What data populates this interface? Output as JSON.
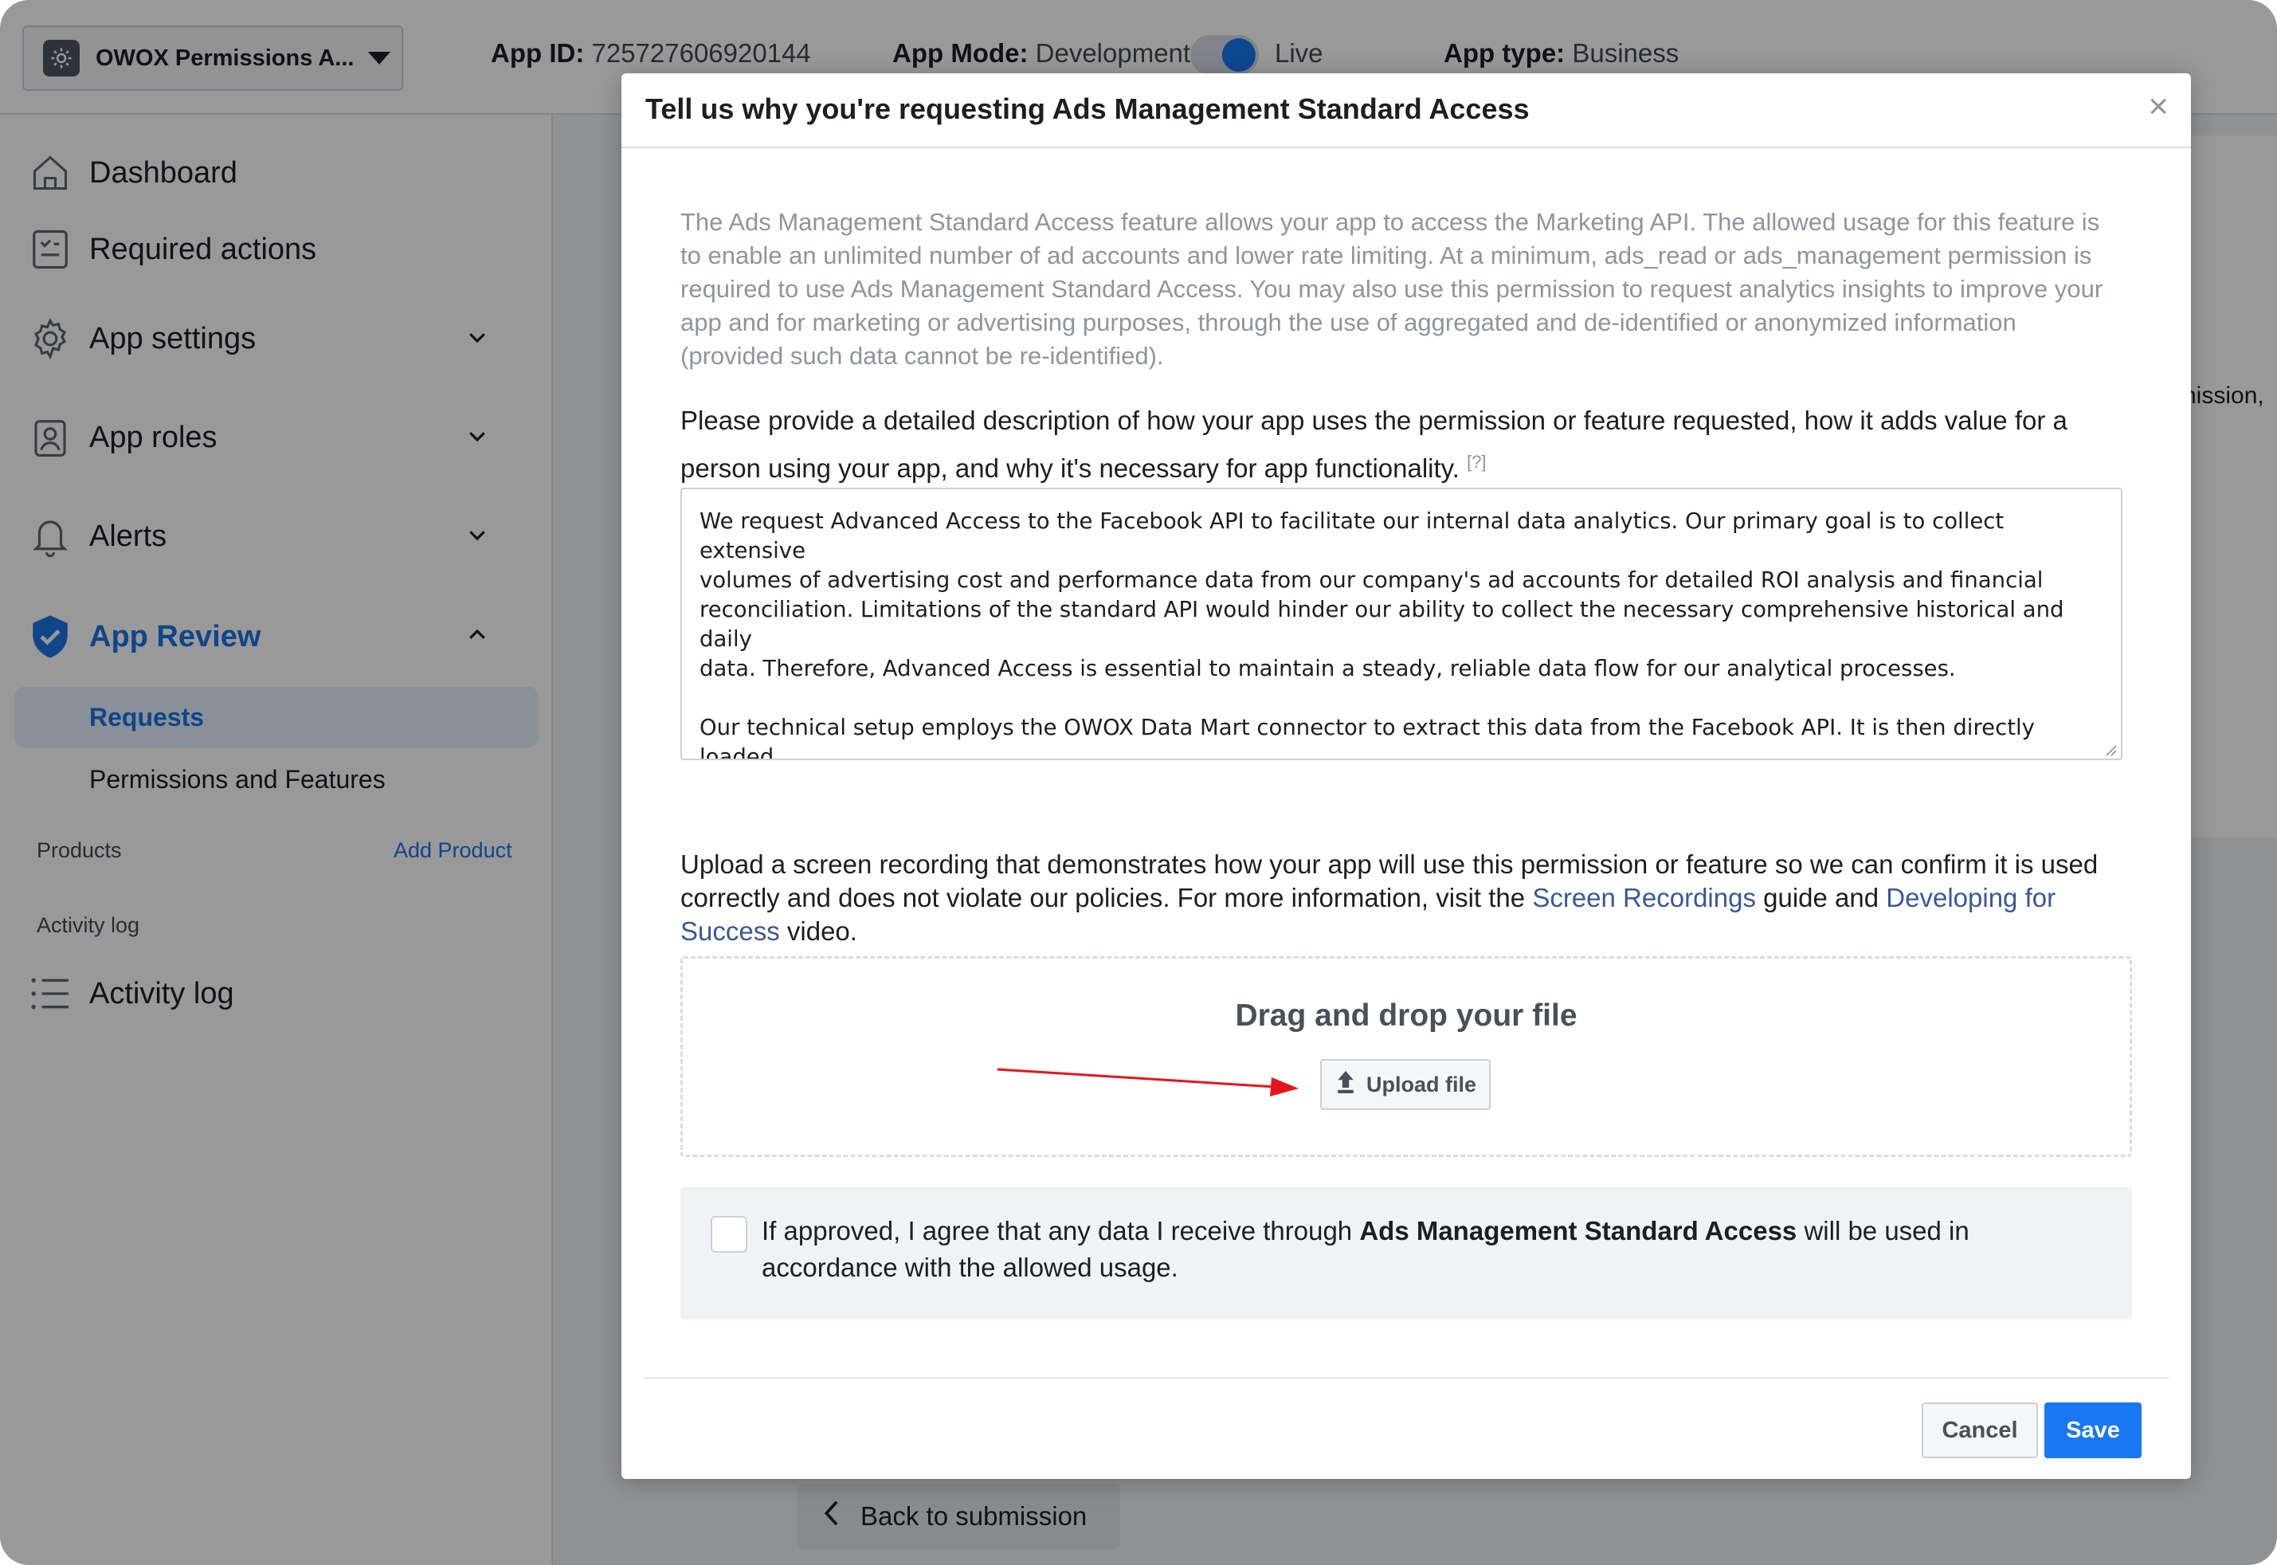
{
  "topbar": {
    "app_name": "OWOX Permissions A...",
    "app_id_label": "App ID:",
    "app_id_value": "725727606920144",
    "app_mode_label": "App Mode:",
    "app_mode_value": "Development",
    "live_label": "Live",
    "app_type_label": "App type:",
    "app_type_value": "Business"
  },
  "sidebar": {
    "items": [
      {
        "label": "Dashboard",
        "icon": "house-icon"
      },
      {
        "label": "Required actions",
        "icon": "checklist-icon"
      },
      {
        "label": "App settings",
        "icon": "gear-icon"
      },
      {
        "label": "App roles",
        "icon": "id-badge-icon"
      },
      {
        "label": "Alerts",
        "icon": "bell-icon"
      },
      {
        "label": "App Review",
        "icon": "shield-check-icon"
      }
    ],
    "sub_items": [
      {
        "label": "Requests"
      },
      {
        "label": "Permissions and Features"
      }
    ],
    "products_label": "Products",
    "add_product_label": "Add Product",
    "activity_section_label": "Activity log",
    "activity_item_label": "Activity log"
  },
  "background": {
    "back_label": "Back to submission",
    "peek_text": "nission,"
  },
  "modal": {
    "title": "Tell us why you're requesting Ads Management Standard Access",
    "close_symbol": "×",
    "description": "The Ads Management Standard Access feature allows your app to access the Marketing API. The allowed usage for this feature is to enable an unlimited number of ad accounts and lower rate limiting. At a minimum, ads_read or ads_management permission is required to use Ads Management Standard Access. You may also use this permission to request analytics insights to improve your app and for marketing or advertising purposes, through the use of aggregated and de-identified or anonymized information (provided such data cannot be re-identified).",
    "prompt": "Please provide a detailed description of how your app uses the permission or feature requested, how it adds value for a person using your app, and why it's necessary for app functionality.",
    "prompt_help": "[?]",
    "textarea_value": "We request Advanced Access to the Facebook API to facilitate our internal data analytics. Our primary goal is to collect extensive\nvolumes of advertising cost and performance data from our company's ad accounts for detailed ROI analysis and financial\nreconciliation. Limitations of the standard API would hinder our ability to collect the necessary comprehensive historical and daily\ndata. Therefore, Advanced Access is essential to maintain a steady, reliable data flow for our analytical processes.\n\nOur technical setup employs the OWOX Data Mart connector to extract this data from the Facebook API. It is then directly loaded\ninto our Google BigQuery (GBQ) data warehouse, where it’s used solely for internal analysis. This system works exclusively with our\nproprietary data.",
    "upload_text_1": "Upload a screen recording that demonstrates how your app will use this permission or feature so we can confirm it is used correctly and does not violate our policies. For more information, visit the ",
    "upload_link_1": "Screen Recordings",
    "upload_text_2": " guide and ",
    "upload_link_2": "Developing for Success",
    "upload_text_3": " video.",
    "drop_title": "Drag and drop your file",
    "upload_button": "Upload file",
    "agree_text_1": "If approved, I agree that any data I receive through ",
    "agree_bold": "Ads Management Standard Access",
    "agree_text_2": " will be used in accordance with the allowed usage.",
    "agree_checked": false,
    "cancel_label": "Cancel",
    "save_label": "Save"
  },
  "colors": {
    "accent": "#1877f2",
    "link": "#385898",
    "annotation_arrow": "#e8141c"
  }
}
